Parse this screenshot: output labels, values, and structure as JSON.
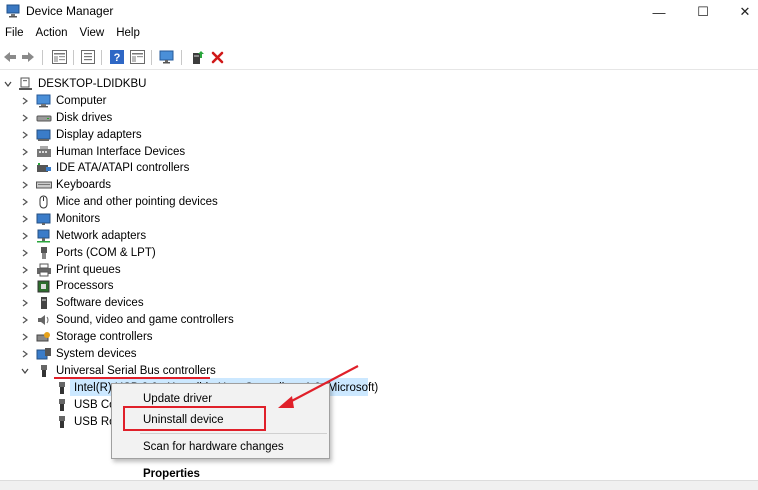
{
  "window": {
    "title": "Device Manager",
    "min_glyph": "—",
    "max_glyph": "☐",
    "close_glyph": "✕"
  },
  "menu": [
    "File",
    "Action",
    "View",
    "Help"
  ],
  "tree": {
    "root": "DESKTOP-LDIDKBU",
    "categories": [
      {
        "label": "Computer",
        "icon": "computer-icon"
      },
      {
        "label": "Disk drives",
        "icon": "disk-drive-icon"
      },
      {
        "label": "Display adapters",
        "icon": "display-adapter-icon"
      },
      {
        "label": "Human Interface Devices",
        "icon": "hid-icon"
      },
      {
        "label": "IDE ATA/ATAPI controllers",
        "icon": "ide-controller-icon"
      },
      {
        "label": "Keyboards",
        "icon": "keyboard-icon"
      },
      {
        "label": "Mice and other pointing devices",
        "icon": "mouse-icon"
      },
      {
        "label": "Monitors",
        "icon": "monitor-icon"
      },
      {
        "label": "Network adapters",
        "icon": "network-adapter-icon"
      },
      {
        "label": "Ports (COM & LPT)",
        "icon": "port-icon"
      },
      {
        "label": "Print queues",
        "icon": "printer-icon"
      },
      {
        "label": "Processors",
        "icon": "processor-icon"
      },
      {
        "label": "Software devices",
        "icon": "software-device-icon"
      },
      {
        "label": "Sound, video and game controllers",
        "icon": "speaker-icon"
      },
      {
        "label": "Storage controllers",
        "icon": "storage-controller-icon"
      },
      {
        "label": "System devices",
        "icon": "system-device-icon"
      },
      {
        "label": "Universal Serial Bus controllers",
        "icon": "usb-icon"
      }
    ],
    "usb_children": [
      "Intel(R) USB 3.0 eXtensible Host Controller - 1.0 (Microsoft)",
      "USB Co",
      "USB Ro"
    ]
  },
  "context_menu": {
    "items": [
      "Update driver",
      "Uninstall device",
      "Scan for hardware changes",
      "Properties"
    ]
  },
  "colors": {
    "selection": "#cce8ff",
    "annotation_red": "#e0202a",
    "menu_bg": "#f2f2f2"
  }
}
